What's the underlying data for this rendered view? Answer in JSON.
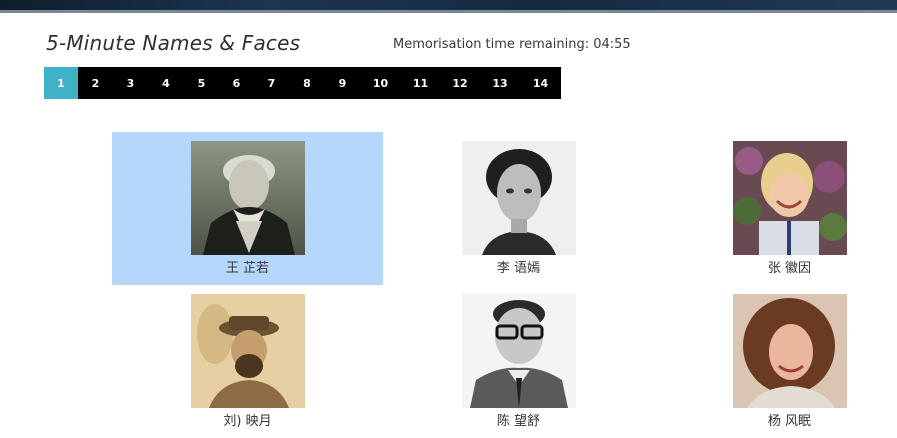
{
  "header": {
    "title": "5-Minute Names & Faces",
    "timer_label": "Memorisation time remaining: 04:55"
  },
  "pagination": {
    "current_page": 1,
    "pages": [
      "1",
      "2",
      "3",
      "4",
      "5",
      "6",
      "7",
      "8",
      "9",
      "10",
      "11",
      "12",
      "13",
      "14"
    ]
  },
  "faces": [
    {
      "name": "王 芷若",
      "selected": true,
      "photo": "elderly-woman-photo"
    },
    {
      "name": "李 语嫣",
      "selected": false,
      "photo": "woman-short-hair-photo"
    },
    {
      "name": "张 徽因",
      "selected": false,
      "photo": "smiling-child-photo"
    },
    {
      "name": "刘) 映月",
      "selected": false,
      "photo": "bearded-man-hat-photo"
    },
    {
      "name": "陈 望舒",
      "selected": false,
      "photo": "man-glasses-photo"
    },
    {
      "name": "杨 风眠",
      "selected": false,
      "photo": "woman-curly-hair-photo"
    }
  ],
  "colors": {
    "accent": "#3fb2c8",
    "selection": "#b5d7fb",
    "pager_background": "#000000"
  }
}
